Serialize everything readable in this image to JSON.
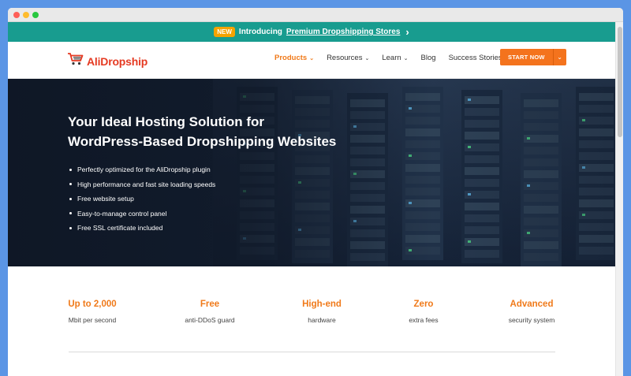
{
  "announcement": {
    "badge": "NEW",
    "text": "Introducing",
    "link": "Premium Dropshipping Stores"
  },
  "logo": {
    "text": "AliDropship"
  },
  "nav": {
    "items": [
      {
        "label": "Products",
        "has_caret": true,
        "active": true
      },
      {
        "label": "Resources",
        "has_caret": true
      },
      {
        "label": "Learn",
        "has_caret": true
      },
      {
        "label": "Blog",
        "has_caret": false
      },
      {
        "label": "Success Stories",
        "has_caret": false
      }
    ],
    "cta_label": "START NOW",
    "caret": "⌄"
  },
  "hero": {
    "title_line1": "Your Ideal Hosting Solution for",
    "title_line2": "WordPress-Based Dropshipping Websites",
    "features": [
      "Perfectly optimized for the AliDropship plugin",
      "High performance and fast site loading speeds",
      "Free website setup",
      "Easy-to-manage control panel",
      "Free SSL certificate included"
    ]
  },
  "stats": [
    {
      "value": "Up to 2,000",
      "label": "Mbit per second"
    },
    {
      "value": "Free",
      "label": "anti-DDoS guard"
    },
    {
      "value": "High-end",
      "label": "hardware"
    },
    {
      "value": "Zero",
      "label": "extra fees"
    },
    {
      "value": "Advanced",
      "label": "security system"
    }
  ],
  "colors": {
    "brand_orange": "#f4731d",
    "logo_red": "#e53a22",
    "announce_teal": "#189c8f",
    "page_bg": "#5b95e5"
  }
}
